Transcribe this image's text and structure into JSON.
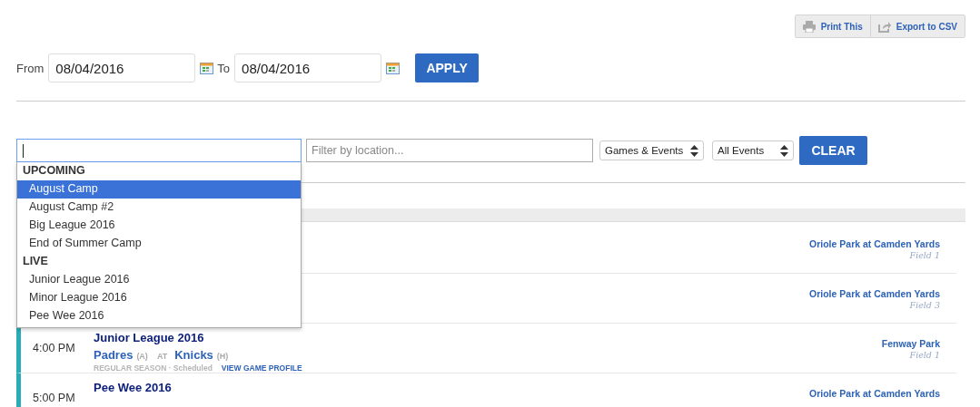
{
  "toolbar": {
    "buttons": [
      {
        "label": "Print This",
        "kind": "print"
      },
      {
        "label": "Export to CSV",
        "kind": "export"
      }
    ]
  },
  "date_range": {
    "from_label": "From",
    "from_value": "08/04/2016",
    "to_label": "To",
    "to_value": "08/04/2016",
    "apply": "APPLY"
  },
  "filters": {
    "search": {
      "focused": true
    },
    "location": {
      "placeholder": "Filter by location..."
    },
    "selects": [
      "Games & Events",
      "All Events"
    ],
    "clear": "CLEAR"
  },
  "dropdown": {
    "groups": [
      {
        "label": "UPCOMING",
        "items": [
          {
            "label": "August Camp",
            "selected": true
          },
          {
            "label": "August Camp #2",
            "selected": false
          },
          {
            "label": "Big League 2016",
            "selected": false
          },
          {
            "label": "End of Summer Camp",
            "selected": false
          }
        ]
      },
      {
        "label": "LIVE",
        "items": [
          {
            "label": "Junior League 2016",
            "selected": false
          },
          {
            "label": "Minor League 2016",
            "selected": false
          },
          {
            "label": "Pee Wee 2016",
            "selected": false
          }
        ]
      }
    ]
  },
  "events": [
    {
      "location": "Oriole Park at Camden Yards",
      "field": "Field 1"
    },
    {
      "location": "Oriole Park at Camden Yards",
      "field": "Field 3"
    },
    {
      "time": "4:00 PM",
      "title": "Junior League 2016",
      "away_team": "Padres",
      "away_tag": "(A)",
      "separator": "AT",
      "home_team": "Knicks",
      "home_tag": "(H)",
      "meta": "REGULAR SEASON · Scheduled",
      "link": "VIEW GAME PROFILE",
      "location": "Fenway Park",
      "field": "Field 1"
    },
    {
      "time": "5:00 PM",
      "title": "Pee Wee 2016",
      "location": "Oriole Park at Camden Yards"
    }
  ]
}
